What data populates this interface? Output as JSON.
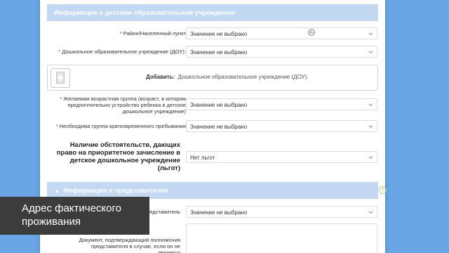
{
  "institution_section": {
    "title": "Информация о детском образовательном учреждении",
    "district": {
      "label": "Район/Населенный пункт",
      "value": "Значение не выбрано"
    },
    "kindergarten": {
      "label": "Дошкольное образовательное учреждение (ДОУ):",
      "value": "Значение не выбрано"
    },
    "add_block": {
      "bold_label": "Добавить:",
      "text": "Дошкольное образовательное учреждение (ДОУ)."
    },
    "age_group": {
      "label_lines": [
        "Желаемая возрастная группа (возраст, в котором",
        "предпочтительно устройство ребенка в детское",
        "дошкольное учреждение)"
      ],
      "value": "Значение не выбрано"
    },
    "short_stay": {
      "label": "Необходима группа кратковременного пребывания",
      "value": "Значение не выбрано"
    },
    "privileges": {
      "label_lines": [
        "Наличие обстоятельств, дающих",
        "право на приоритетное зачисление в",
        "детское дошкольное учреждение",
        "(льгот)"
      ],
      "value": "Нет льгот"
    }
  },
  "representatives_section": {
    "title": "Информация о представителях",
    "representative": {
      "label": "Представитель",
      "value": "Значение не выбрано"
    },
    "document": {
      "label_lines": [
        "Документ, подтверждающий полномочия",
        "представителя в случае, если он не является"
      ]
    }
  },
  "caption": {
    "lines": [
      "Адрес фактического",
      "проживания"
    ]
  },
  "colors": {
    "background": "#6aa6e6",
    "section_header": "#c3d8f3",
    "required": "#cc2222",
    "caption_bg": "#3c3c3c"
  },
  "icons": {
    "select_arrow": "chevron-down-icon",
    "add": "add-document-icon",
    "help": "help-icon"
  }
}
